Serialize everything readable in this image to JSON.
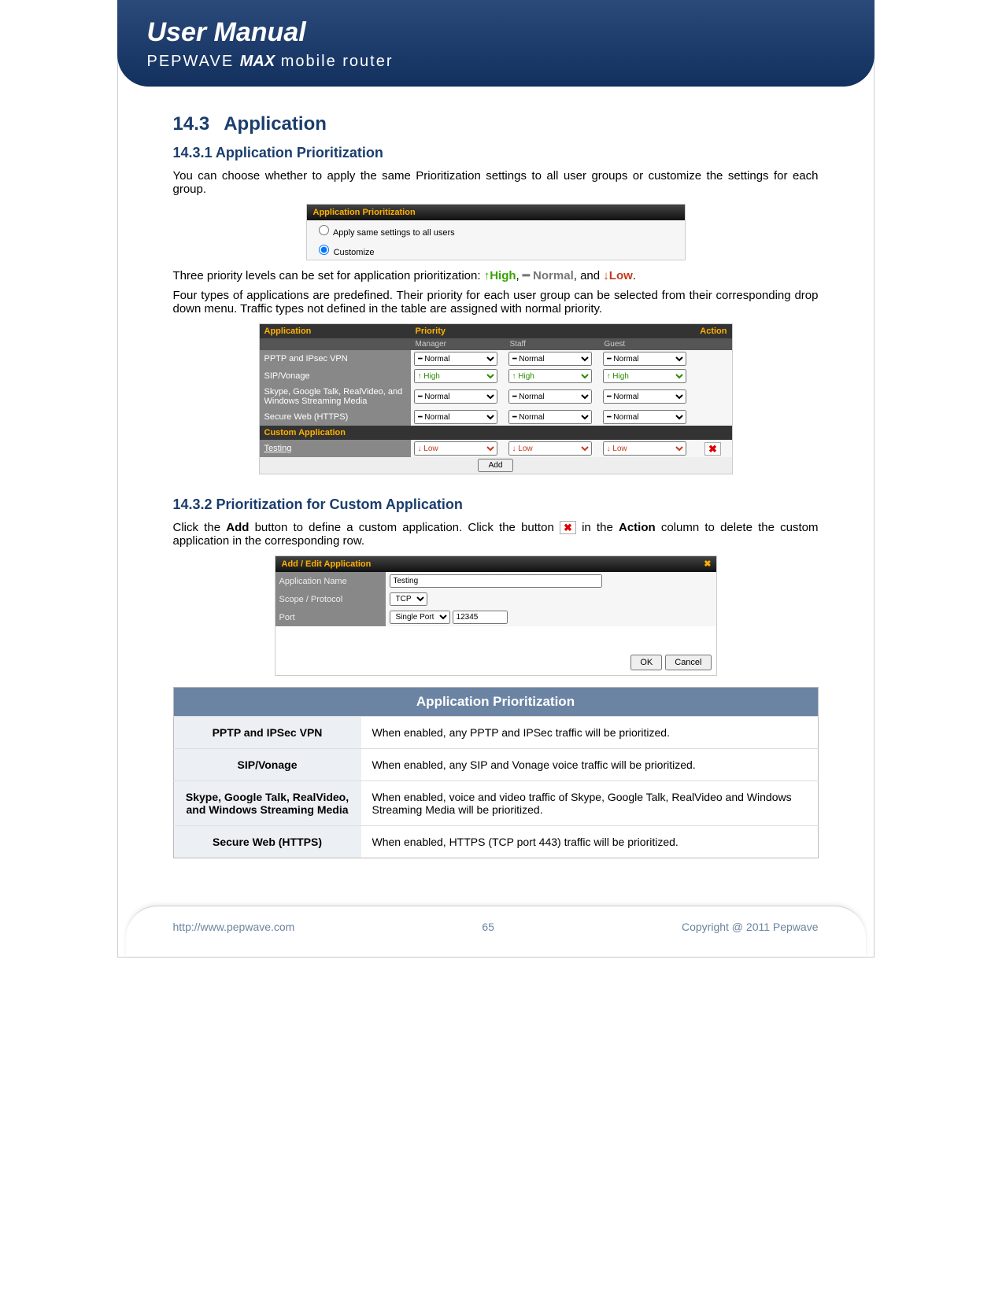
{
  "header": {
    "title": "User Manual",
    "sub_brand": "PEPWAVE",
    "sub_prod": "MAX",
    "sub_tail": " mobile router"
  },
  "s143": {
    "num": "14.3",
    "title": "Application"
  },
  "s1431": {
    "title": "14.3.1 Application Prioritization",
    "p1": "You can choose whether to apply the same Prioritization settings to all user groups or customize the settings for each group.",
    "p2_a": "Three priority levels can be set for application prioritization: ",
    "hi": "↑High",
    "nm": "━ Normal",
    "lw": "↓Low",
    "p3": "Four types of applications are predefined.  Their priority for each user group can be selected from their corresponding drop down menu. Traffic types not defined in the table are assigned with normal priority."
  },
  "ss1": {
    "bar": "Application Prioritization",
    "opt1": "Apply same settings to all users",
    "opt2": "Customize"
  },
  "ss2": {
    "h_app": "Application",
    "h_pri": "Priority",
    "h_act": "Action",
    "sub1": "Manager",
    "sub2": "Staff",
    "sub3": "Guest",
    "r1": "PPTP and IPsec VPN",
    "r2": "SIP/Vonage",
    "r3": "Skype, Google Talk, RealVideo, and Windows Streaming Media",
    "r4": "Secure Web (HTTPS)",
    "custom": "Custom Application",
    "r5": "Testing",
    "add": "Add",
    "opN": "━ Normal",
    "opH": "↑ High",
    "opL": "↓ Low"
  },
  "s1432": {
    "title": "14.3.2 Prioritization for Custom Application",
    "p_a": "Click the ",
    "p_b": "Add",
    "p_c": " button to define a custom application.  Click the button ",
    "p_d": " in the ",
    "p_e": "Action",
    "p_f": " column to delete the custom application in the corresponding row."
  },
  "ss3": {
    "bar": "Add / Edit Application",
    "l1": "Application Name",
    "v1": "Testing",
    "l2": "Scope / Protocol",
    "v2": "TCP",
    "l3": "Port",
    "v3a": "Single Port",
    "v3b": "12345",
    "ok": "OK",
    "cancel": "Cancel"
  },
  "def": {
    "title": "Application Prioritization",
    "rows": [
      {
        "n": "PPTP and IPSec VPN",
        "d": "When enabled, any PPTP and IPSec traffic will be prioritized."
      },
      {
        "n": "SIP/Vonage",
        "d": "When enabled, any SIP and Vonage voice traffic will be prioritized."
      },
      {
        "n": "Skype, Google Talk, RealVideo, and Windows Streaming Media",
        "d": "When enabled, voice and video traffic of Skype, Google Talk, RealVideo and Windows Streaming Media will be prioritized."
      },
      {
        "n": "Secure Web (HTTPS)",
        "d": "When enabled, HTTPS (TCP port 443) traffic will be prioritized."
      }
    ]
  },
  "footer": {
    "url": "http://www.pepwave.com",
    "page": "65",
    "copy": "Copyright @ 2011 Pepwave"
  }
}
